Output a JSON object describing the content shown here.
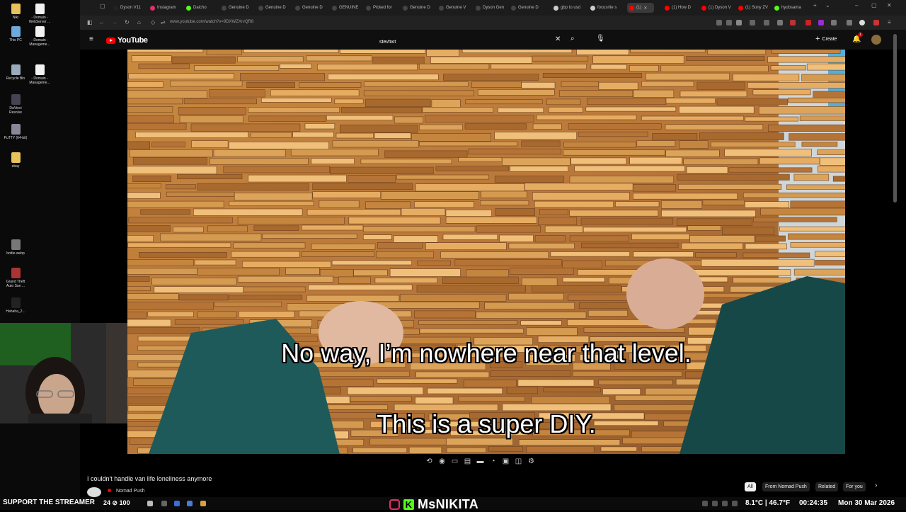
{
  "desktop_icons": [
    {
      "label": "Niki",
      "color": "#e8c25a"
    },
    {
      "label": "- Domain - WebServer ...",
      "color": "#f2f2f2"
    },
    {
      "label": "This PC",
      "color": "#6fa8dc"
    },
    {
      "label": "- Domain - Manageme...",
      "color": "#f2f2f2"
    },
    {
      "label": "Recycle Bin",
      "color": "#9ab"
    },
    {
      "label": "- Domain - Manageme...",
      "color": "#f2f2f2"
    },
    {
      "label": "DaVinci Resolve",
      "color": "#445"
    },
    {
      "label": "PuTTY (64-bit)",
      "color": "#889"
    },
    {
      "label": "ebay",
      "color": "#e8c25a"
    },
    {
      "label": "bottle.webp",
      "color": "#777"
    },
    {
      "label": "Grand Theft Auto San ...",
      "color": "#a33"
    },
    {
      "label": "Hahaha_2...",
      "color": "#222"
    }
  ],
  "tabs": [
    {
      "label": "Dyson V11",
      "color": "#222",
      "active": false
    },
    {
      "label": "Instagram",
      "color": "#e1306c",
      "active": false
    },
    {
      "label": "Daicho",
      "color": "#53fc18",
      "active": false
    },
    {
      "label": "Genuine D",
      "color": "#444",
      "active": false
    },
    {
      "label": "Genuine D",
      "color": "#444",
      "active": false
    },
    {
      "label": "Genuine D",
      "color": "#444",
      "active": false
    },
    {
      "label": "GENUINE",
      "color": "#444",
      "active": false
    },
    {
      "label": "Picked for",
      "color": "#444",
      "active": false
    },
    {
      "label": "Genuine D",
      "color": "#444",
      "active": false
    },
    {
      "label": "Genuine V",
      "color": "#444",
      "active": false
    },
    {
      "label": "Dyson Gen",
      "color": "#444",
      "active": false
    },
    {
      "label": "Genuine D",
      "color": "#444",
      "active": false
    },
    {
      "label": "gbp to usd",
      "color": "#ccc",
      "active": false
    },
    {
      "label": "focusrite s",
      "color": "#ccc",
      "active": false
    },
    {
      "label": "(1)",
      "color": "#ff0000",
      "active": true
    },
    {
      "label": "(1) How D",
      "color": "#ff0000",
      "active": false
    },
    {
      "label": "(1) Dyson V",
      "color": "#ff0000",
      "active": false
    },
    {
      "label": "(1) Sony ZV",
      "color": "#ff0000",
      "active": false
    },
    {
      "label": "hyubsama",
      "color": "#53fc18",
      "active": false
    }
  ],
  "address": {
    "url": "www.youtube.com/watch?v=9DXWZXrvQR8"
  },
  "youtube": {
    "logo": "YouTube",
    "search_value": "stevfixit",
    "create_label": "Create",
    "notification_count": "1"
  },
  "video": {
    "caption_top": "No way, I’m nowhere near that level.",
    "caption_bottom": "This is a super DIY."
  },
  "below": {
    "title": "I couldn't handle van life loneliness anymore",
    "channel": "Nomad Push",
    "chips": [
      "All",
      "From Nomad Push",
      "Related",
      "For you"
    ]
  },
  "taskbar": {
    "support": "SUPPORT THE STREAMER",
    "kick_stats": "24 ⊘ 100",
    "brand": "MsNIKITA",
    "weather": "8.1°C | 46.7°F",
    "timer": "00:24:35",
    "date": "Mon 30 Mar 2026"
  }
}
